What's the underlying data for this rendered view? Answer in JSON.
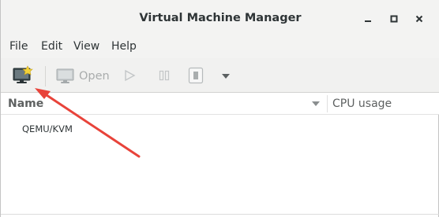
{
  "window": {
    "title": "Virtual Machine Manager"
  },
  "menubar": {
    "items": [
      {
        "label": "File"
      },
      {
        "label": "Edit"
      },
      {
        "label": "View"
      },
      {
        "label": "Help"
      }
    ]
  },
  "toolbar": {
    "open_label": "Open",
    "icons": [
      "new-vm-icon",
      "monitor-icon",
      "play-icon",
      "pause-icon",
      "shutdown-icon",
      "chevron-down-icon"
    ]
  },
  "vm_list": {
    "columns": [
      {
        "label": "Name"
      },
      {
        "label": "CPU usage"
      }
    ],
    "rows": [
      {
        "name": "QEMU/KVM"
      }
    ]
  },
  "annotation": {
    "arrow_color": "#e8433a"
  }
}
